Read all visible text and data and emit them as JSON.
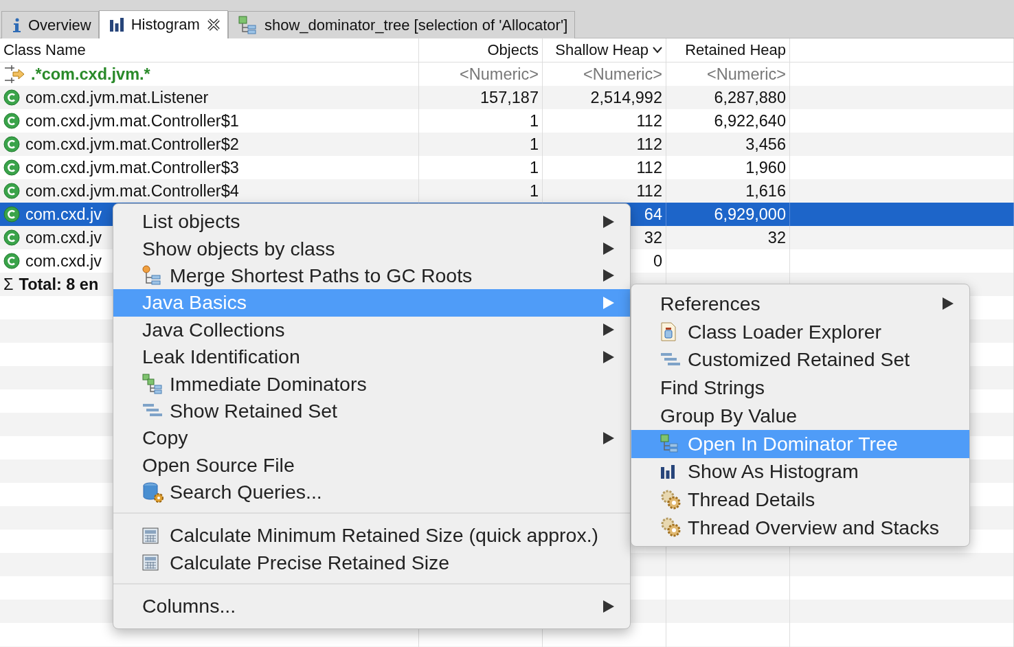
{
  "tabs": [
    {
      "label": "Overview",
      "kind": "info",
      "selected": false
    },
    {
      "label": "Histogram",
      "kind": "histogram",
      "selected": true
    },
    {
      "label": "show_dominator_tree [selection of 'Allocator']",
      "kind": "tree",
      "selected": false
    }
  ],
  "table": {
    "columns": [
      {
        "label": "Class Name",
        "sorted": false
      },
      {
        "label": "Objects",
        "sorted": false
      },
      {
        "label": "Shallow Heap",
        "sorted": true
      },
      {
        "label": "Retained Heap",
        "sorted": false
      }
    ],
    "filter_row": {
      "pattern": ".*com.cxd.jvm.*",
      "placeholders": [
        "<Numeric>",
        "<Numeric>",
        "<Numeric>"
      ]
    },
    "rows": [
      {
        "name": "com.cxd.jvm.mat.Listener",
        "objects": "157,187",
        "shallow_heap": "2,514,992",
        "retained_heap": "6,287,880",
        "selected": false
      },
      {
        "name": "com.cxd.jvm.mat.Controller$1",
        "objects": "1",
        "shallow_heap": "112",
        "retained_heap": "6,922,640",
        "selected": false
      },
      {
        "name": "com.cxd.jvm.mat.Controller$2",
        "objects": "1",
        "shallow_heap": "112",
        "retained_heap": "3,456",
        "selected": false
      },
      {
        "name": "com.cxd.jvm.mat.Controller$3",
        "objects": "1",
        "shallow_heap": "112",
        "retained_heap": "1,960",
        "selected": false
      },
      {
        "name": "com.cxd.jvm.mat.Controller$4",
        "objects": "1",
        "shallow_heap": "112",
        "retained_heap": "1,616",
        "selected": false
      },
      {
        "name": "com.cxd.jv",
        "shallow_heap": "64",
        "retained_heap": "6,929,000",
        "selected": true
      },
      {
        "name": "com.cxd.jv",
        "shallow_heap": "32",
        "retained_heap": "32",
        "selected": false
      },
      {
        "name": "com.cxd.jv",
        "shallow_heap": "0",
        "selected": false
      }
    ],
    "total": {
      "symbol": "Σ",
      "label": "Total: 8 en"
    }
  },
  "context_menu": {
    "groups": [
      [
        {
          "label": "List objects",
          "kind": "text",
          "submenu": true,
          "selected": false
        },
        {
          "label": "Show objects by class",
          "kind": "text",
          "submenu": true,
          "selected": false
        },
        {
          "label": "Merge Shortest Paths to GC Roots",
          "kind": "merge",
          "submenu": true,
          "selected": false
        },
        {
          "label": "Java Basics",
          "kind": "text",
          "submenu": true,
          "selected": true
        },
        {
          "label": "Java Collections",
          "kind": "text",
          "submenu": true,
          "selected": false
        },
        {
          "label": "Leak Identification",
          "kind": "text",
          "submenu": true,
          "selected": false
        },
        {
          "label": "Immediate Dominators",
          "kind": "dominators",
          "submenu": false,
          "selected": false
        },
        {
          "label": "Show Retained Set",
          "kind": "retained",
          "submenu": false,
          "selected": false
        },
        {
          "label": "Copy",
          "kind": "text",
          "submenu": true,
          "selected": false
        },
        {
          "label": "Open Source File",
          "kind": "text",
          "submenu": false,
          "selected": false
        },
        {
          "label": "Search Queries...",
          "kind": "queries",
          "submenu": false,
          "selected": false
        }
      ],
      [
        {
          "label": "Calculate Minimum Retained Size (quick approx.)",
          "kind": "calculator",
          "submenu": false,
          "selected": false
        },
        {
          "label": "Calculate Precise Retained Size",
          "kind": "calculator",
          "submenu": false,
          "selected": false
        }
      ],
      [
        {
          "label": "Columns...",
          "kind": "text",
          "submenu": true,
          "selected": false
        }
      ]
    ]
  },
  "submenu": {
    "items": [
      {
        "label": "References",
        "kind": "text",
        "submenu": true,
        "selected": false
      },
      {
        "label": "Class Loader Explorer",
        "kind": "loader",
        "submenu": false,
        "selected": false
      },
      {
        "label": "Customized Retained Set",
        "kind": "retained",
        "submenu": false,
        "selected": false
      },
      {
        "label": "Find Strings",
        "kind": "text",
        "submenu": false,
        "selected": false
      },
      {
        "label": "Group By Value",
        "kind": "text",
        "submenu": false,
        "selected": false
      },
      {
        "label": "Open In Dominator Tree",
        "kind": "tree",
        "submenu": false,
        "selected": true
      },
      {
        "label": "Show As Histogram",
        "kind": "histogram",
        "submenu": false,
        "selected": false
      },
      {
        "label": "Thread Details",
        "kind": "gears",
        "submenu": false,
        "selected": false
      },
      {
        "label": "Thread Overview and Stacks",
        "kind": "gears",
        "submenu": false,
        "selected": false
      }
    ]
  }
}
